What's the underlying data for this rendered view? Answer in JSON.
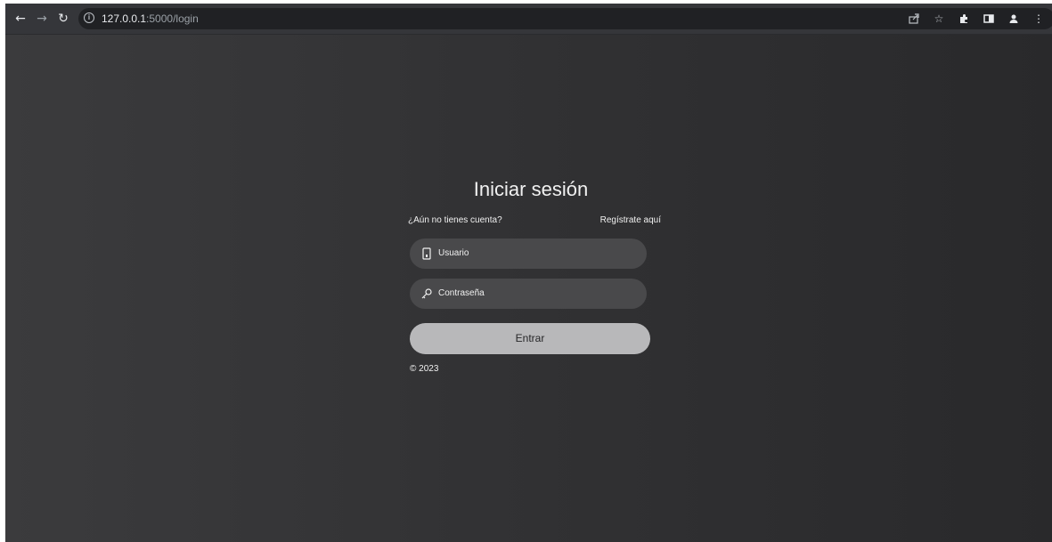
{
  "browser": {
    "url_host": "127.0.0.1",
    "url_rest": ":5000/login",
    "icons": {
      "back": "arrow-left-icon",
      "forward": "arrow-right-icon",
      "reload": "reload-icon",
      "info": "info-icon",
      "share": "share-icon",
      "bookmark": "star-icon",
      "extensions": "puzzle-icon",
      "sidepanel": "side-panel-icon",
      "profile": "profile-icon",
      "menu": "kebab-menu-icon"
    }
  },
  "login": {
    "title": "Iniciar sesión",
    "no_account_text": "¿Aún no tienes cuenta?",
    "register_link": "Regístrate aquí",
    "username_placeholder": "Usuario",
    "password_placeholder": "Contraseña",
    "submit_label": "Entrar",
    "copyright": "© 2023"
  },
  "colors": {
    "page_background": "#323234",
    "field_background": "#49494b",
    "button_background": "#b8b8ba",
    "text": "#f1f1f1"
  }
}
